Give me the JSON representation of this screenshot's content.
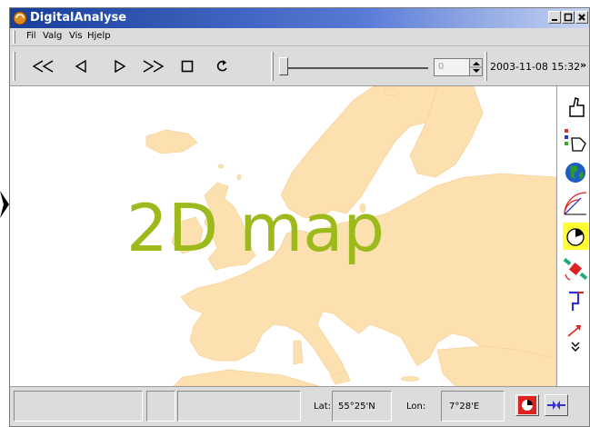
{
  "window": {
    "title": "DigitalAnalyse"
  },
  "menu": {
    "items": [
      "Fil",
      "Valg",
      "Vis",
      "Hjelp"
    ]
  },
  "toolbar": {
    "buttons": [
      "rewind-fast-icon",
      "step-back-icon",
      "play-icon",
      "fast-forward-icon",
      "stop-icon",
      "refresh-icon"
    ],
    "slider_value": 0,
    "spinner_value": "0",
    "datetime": "2003-11-08 15:32",
    "more": "»"
  },
  "map": {
    "overlay_text": "2D map",
    "land_color": "#fde0b0",
    "overlay_color": "#9dba1c"
  },
  "right_toolbar": {
    "icons": [
      "thumbs-up-icon",
      "pointing-hand-icon",
      "globe-icon",
      "radar-icon",
      "gauge-icon",
      "satellite-icon",
      "route-icon",
      "arrow-icon"
    ],
    "more": "»"
  },
  "status": {
    "lat_label": "Lat:",
    "lat_value": "55°25'N",
    "lon_label": "Lon:",
    "lon_value": "7°28'E"
  }
}
